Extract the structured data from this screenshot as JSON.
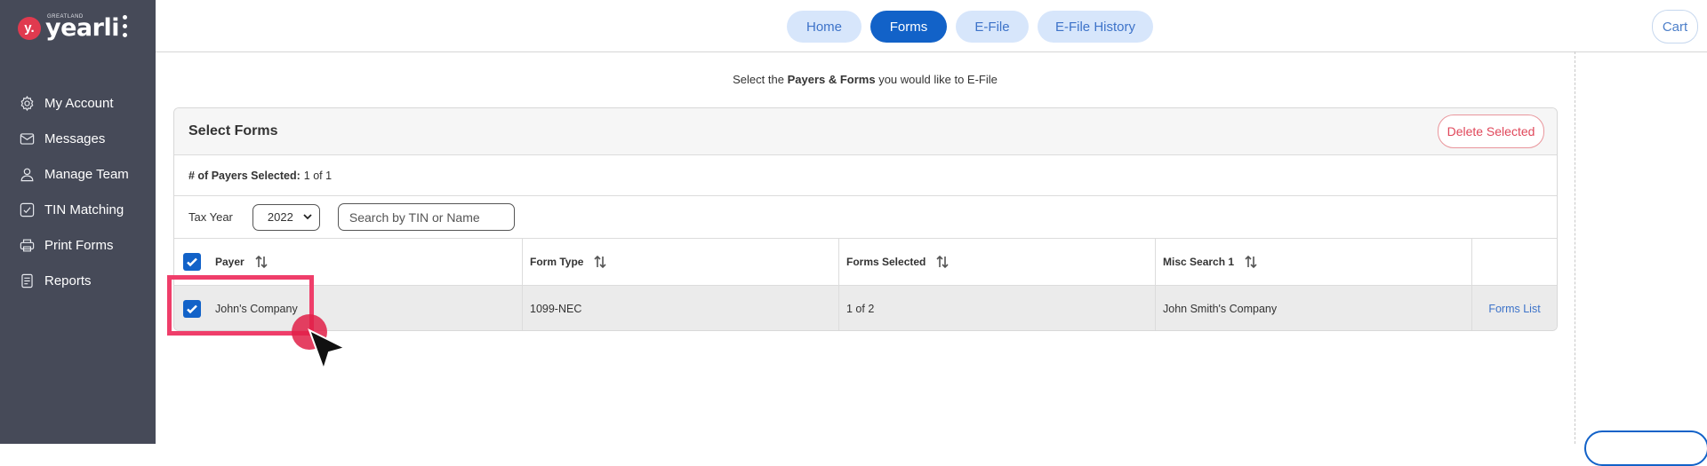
{
  "app": {
    "logo_small": "GREATLAND",
    "logo_text": "yearli",
    "logo_mark": "y."
  },
  "sidebar": {
    "items": [
      {
        "label": "My Account",
        "icon": "gear-icon"
      },
      {
        "label": "Messages",
        "icon": "envelope-icon"
      },
      {
        "label": "Manage Team",
        "icon": "person-icon"
      },
      {
        "label": "TIN Matching",
        "icon": "check-square-icon"
      },
      {
        "label": "Print Forms",
        "icon": "printer-icon"
      },
      {
        "label": "Reports",
        "icon": "report-icon"
      }
    ]
  },
  "topnav": {
    "tabs": [
      "Home",
      "Forms",
      "E-File",
      "E-File History"
    ],
    "active_tab": "Forms",
    "cart_label": "Cart"
  },
  "instruction": {
    "prefix": "Select the ",
    "bold": "Payers & Forms",
    "suffix": " you would like to E-File"
  },
  "card": {
    "title": "Select Forms",
    "delete_label": "Delete Selected",
    "payers_selected_label": "# of Payers Selected:",
    "payers_selected_value": "1 of 1",
    "tax_year_label": "Tax Year",
    "tax_year_value": "2022",
    "search_placeholder": "Search by TIN or Name"
  },
  "table": {
    "headers": [
      "Payer",
      "Form Type",
      "Forms Selected",
      "Misc Search 1"
    ],
    "rows": [
      {
        "payer": "John's Company",
        "form_type": "1099-NEC",
        "forms_selected": "1 of 2",
        "misc_search_1": "John Smith's Company",
        "action": "Forms List",
        "checked": true
      }
    ]
  },
  "colors": {
    "sidebar_bg": "#464a58",
    "accent": "#1262c8",
    "tab_bg": "#d7e6fb",
    "danger": "#e0475a",
    "highlight": "#ef3e6a"
  }
}
